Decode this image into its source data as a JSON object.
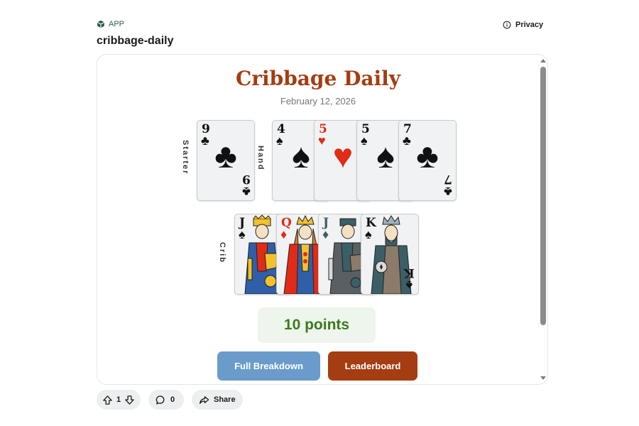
{
  "header": {
    "app_badge": "APP",
    "app_name": "cribbage-daily",
    "privacy_label": "Privacy"
  },
  "game": {
    "title": "Cribbage Daily",
    "date": "February 12, 2026",
    "labels": {
      "starter": "Starter",
      "hand": "Hand",
      "crib": "Crib"
    },
    "starter": {
      "rank": "9",
      "suit": "♣",
      "color": "black"
    },
    "hand": [
      {
        "rank": "4",
        "suit": "♠",
        "color": "black"
      },
      {
        "rank": "5",
        "suit": "♥",
        "color": "red"
      },
      {
        "rank": "5",
        "suit": "♠",
        "color": "black"
      },
      {
        "rank": "7",
        "suit": "♣",
        "color": "black"
      }
    ],
    "crib": [
      {
        "rank": "J",
        "suit": "♠",
        "color": "black"
      },
      {
        "rank": "Q",
        "suit": "♦",
        "color": "red"
      },
      {
        "rank": "J",
        "suit": "♦",
        "color": "teal"
      },
      {
        "rank": "K",
        "suit": "♠",
        "color": "black"
      }
    ],
    "score": "10 points",
    "buttons": {
      "breakdown": "Full Breakdown",
      "leaderboard": "Leaderboard"
    }
  },
  "footer": {
    "upvotes": "1",
    "comments": "0",
    "share_label": "Share"
  },
  "colors": {
    "accent": "#a43d12",
    "button_blue": "#6a9bcb",
    "score_green": "#3d7a1d",
    "red_suit": "#e02b17"
  },
  "icons": [
    "cube-icon",
    "info-icon",
    "upvote-icon",
    "downvote-icon",
    "comment-icon",
    "share-icon"
  ]
}
